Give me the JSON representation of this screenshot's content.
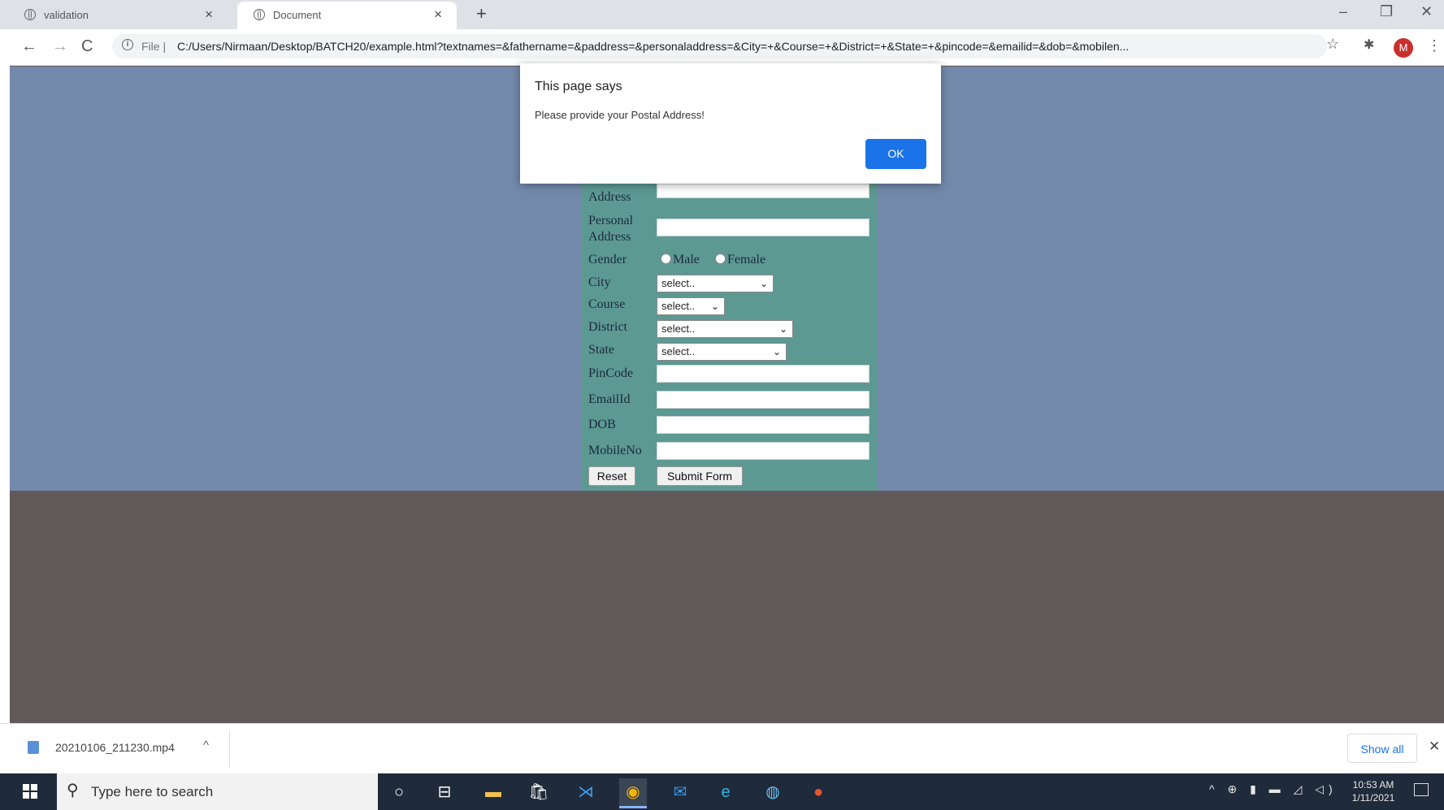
{
  "browser": {
    "tabs": [
      {
        "title": "validation",
        "active": false
      },
      {
        "title": "Document",
        "active": true
      }
    ],
    "new_tab": "+",
    "window_controls": {
      "minimize": "–",
      "restore": "❐",
      "close": "✕"
    },
    "nav": {
      "back": "←",
      "forward": "→",
      "reload": "C"
    },
    "address": {
      "scheme": "File |",
      "url": "C:/Users/Nirmaan/Desktop/BATCH20/example.html?textnames=&fathername=&paddress=&personaladdress=&City=+&Course=+&District=+&State=+&pincode=&emailid=&dob=&mobilen..."
    },
    "profile_initial": "M"
  },
  "form": {
    "address_label": "Address",
    "personal_address_label": "Personal Address",
    "gender_label": "Gender",
    "gender_options": [
      "Male",
      "Female"
    ],
    "city_label": "City",
    "city_value": "select..",
    "course_label": "Course",
    "course_value": "select..",
    "district_label": "District",
    "district_value": "select..",
    "state_label": "State",
    "state_value": "select..",
    "pincode_label": "PinCode",
    "email_label": "EmailId",
    "dob_label": "DOB",
    "mobile_label": "MobileNo",
    "reset_label": "Reset",
    "submit_label": "Submit Form"
  },
  "dialog": {
    "title": "This page says",
    "message": "Please provide your Postal Address!",
    "ok_label": "OK"
  },
  "downloads": {
    "file_name": "20210106_211230.mp4",
    "show_all": "Show all"
  },
  "taskbar": {
    "search_placeholder": "Type here to search",
    "time": "10:53 AM",
    "date": "1/11/2021"
  },
  "colors": {
    "page_background": "#7389ab",
    "form_background": "#5d9993",
    "dialog_button": "#1a73e8",
    "taskbar": "#1f2a3a"
  }
}
